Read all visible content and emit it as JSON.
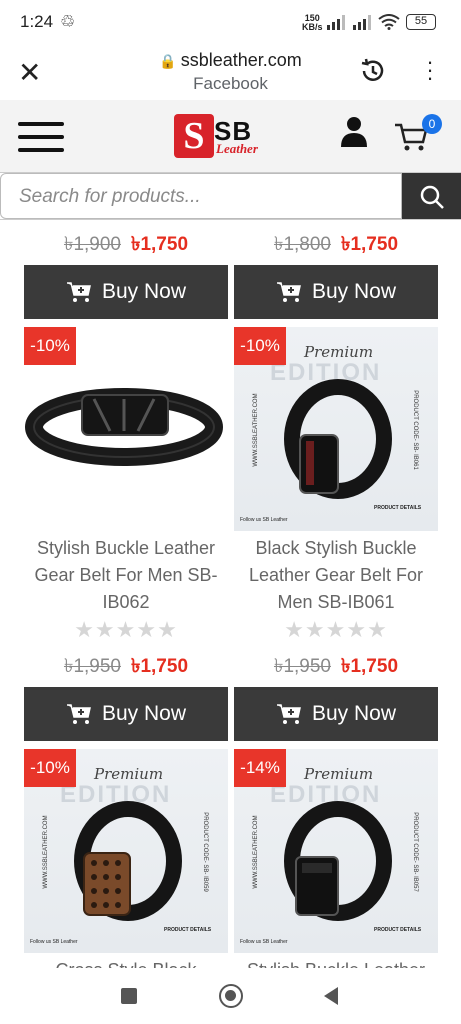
{
  "status": {
    "time": "1:24",
    "speed_value": "150",
    "speed_unit": "KB/s",
    "battery": "55"
  },
  "browser": {
    "domain": "ssbleather.com",
    "origin": "Facebook"
  },
  "header": {
    "logo_mark": "S",
    "logo_text": "SB",
    "logo_sub": "Leather",
    "cart_count": "0"
  },
  "search": {
    "placeholder": "Search for products..."
  },
  "colors": {
    "sale": "#e52e1f",
    "badge": "#e8352a",
    "button": "#3a3a3a",
    "accent": "#1a73e8"
  },
  "buy_label": "Buy Now",
  "top_row": [
    {
      "old_price": "৳1,900",
      "new_price": "৳1,750"
    },
    {
      "old_price": "৳1,800",
      "new_price": "৳1,750"
    }
  ],
  "products": [
    {
      "badge": "-10%",
      "title": "Stylish Buckle Leather Gear Belt For Men SB-IB062",
      "old_price": "৳1,950",
      "new_price": "৳1,750"
    },
    {
      "badge": "-10%",
      "title": "Black Stylish Buckle Leather Gear Belt For Men SB-IB061",
      "old_price": "৳1,950",
      "new_price": "৳1,750"
    },
    {
      "badge": "-10%",
      "title": "Cross Style Black"
    },
    {
      "badge": "-14%",
      "title": "Stylish Buckle Leather"
    }
  ],
  "edition": {
    "script": "Premium",
    "word": "EDITION",
    "site": "WWW.SSBLEATHER.COM",
    "follow": "Follow us SB Leather",
    "details": "PRODUCT DETAILS",
    "codes": [
      "PRODUCT CODE- SB- IB061",
      "PRODUCT CODE- SB- IB059",
      "PRODUCT CODE- SB- IB057"
    ]
  }
}
